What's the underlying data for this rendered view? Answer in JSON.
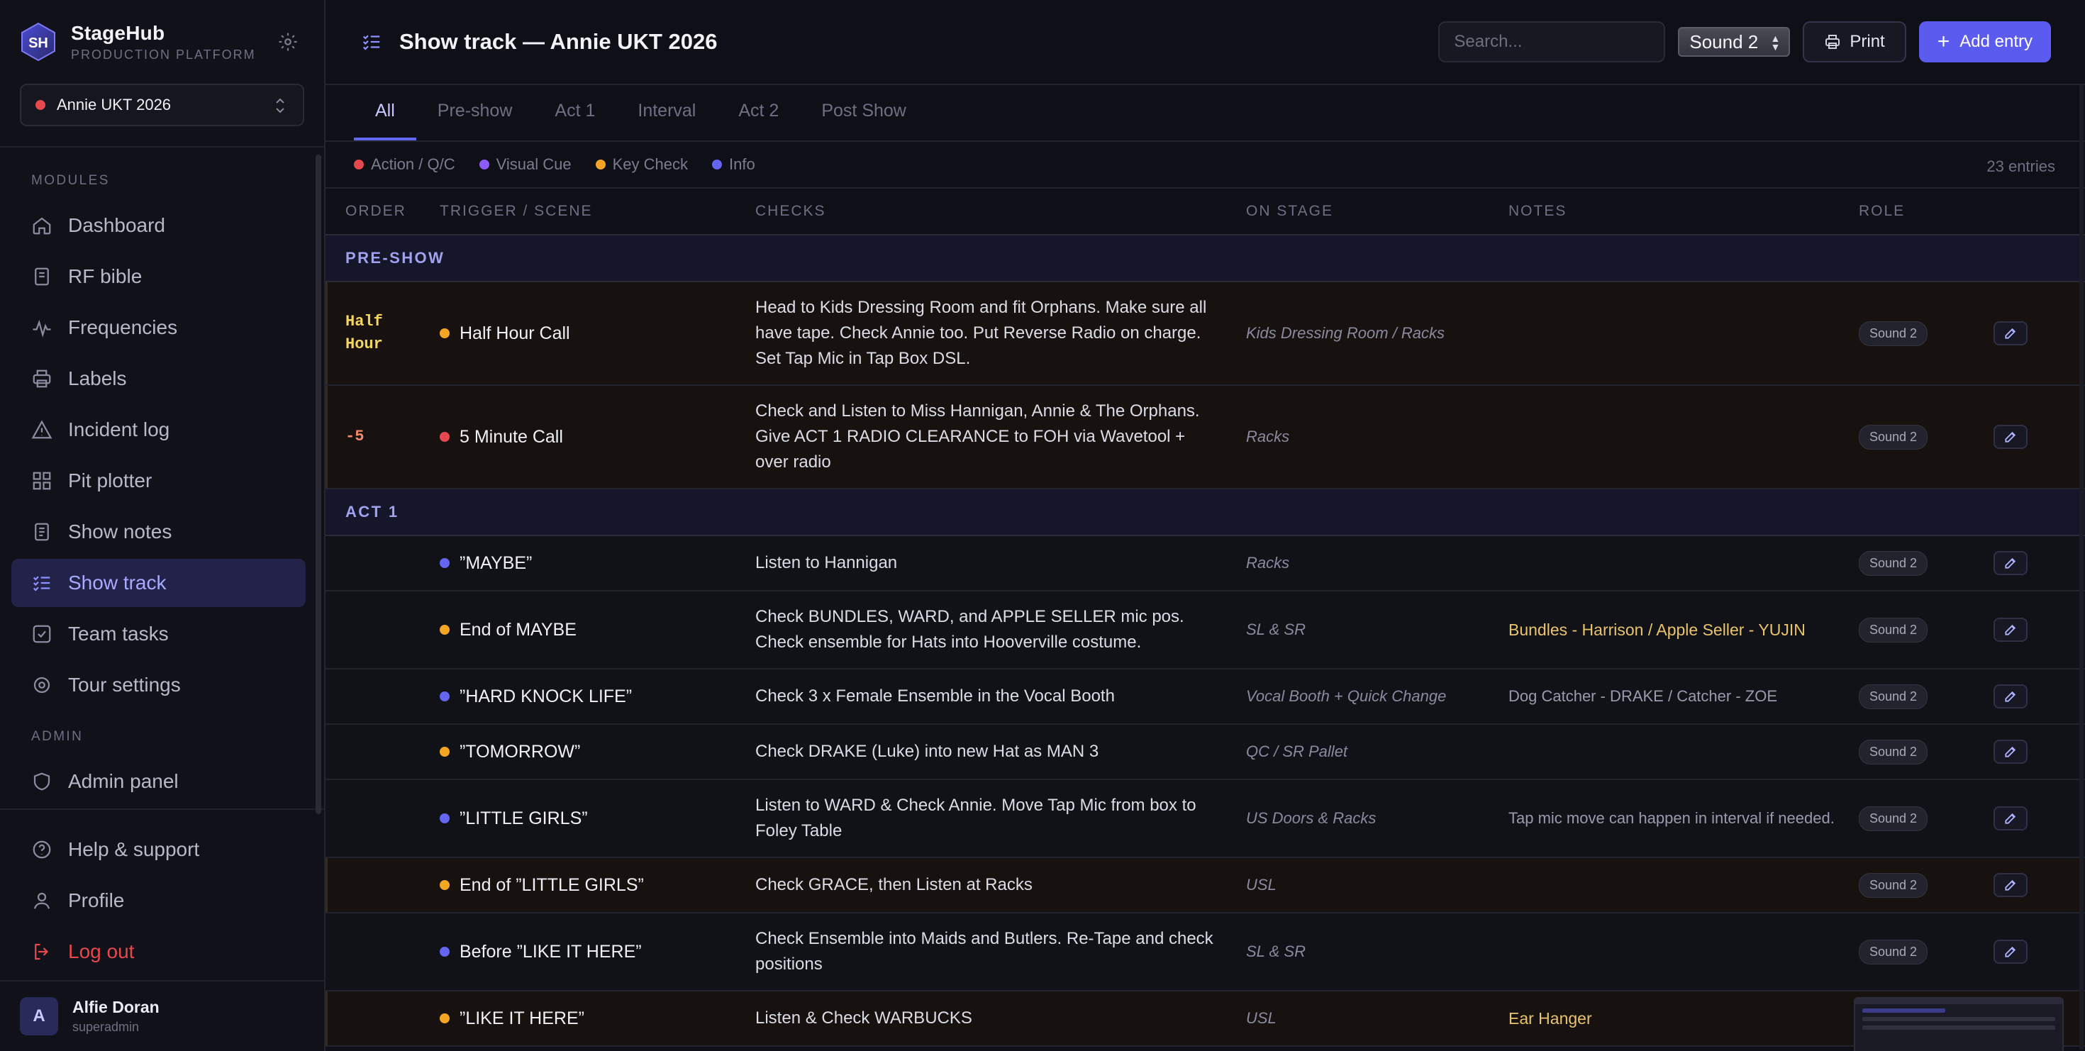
{
  "app": {
    "name": "StageHub",
    "subtitle": "PRODUCTION PLATFORM",
    "logo_text": "SH"
  },
  "production": {
    "label": "Annie UKT 2026",
    "status_color": "#e5484d"
  },
  "sidebar": {
    "modules_label": "MODULES",
    "items": [
      {
        "label": "Dashboard",
        "icon": "home-icon"
      },
      {
        "label": "RF bible",
        "icon": "book-icon"
      },
      {
        "label": "Frequencies",
        "icon": "activity-icon"
      },
      {
        "label": "Labels",
        "icon": "printer-icon"
      },
      {
        "label": "Incident log",
        "icon": "warning-icon"
      },
      {
        "label": "Pit plotter",
        "icon": "grid-icon"
      },
      {
        "label": "Show notes",
        "icon": "notes-icon"
      },
      {
        "label": "Show track",
        "icon": "list-checks-icon",
        "active": true
      },
      {
        "label": "Team tasks",
        "icon": "check-square-icon"
      },
      {
        "label": "Tour settings",
        "icon": "gear-icon"
      }
    ],
    "admin_label": "ADMIN",
    "admin_items": [
      {
        "label": "Admin panel",
        "icon": "shield-icon"
      }
    ],
    "bottom_items": [
      {
        "label": "Help & support",
        "icon": "help-icon"
      },
      {
        "label": "Profile",
        "icon": "user-icon"
      },
      {
        "label": "Log out",
        "icon": "logout-icon"
      }
    ]
  },
  "user": {
    "initial": "A",
    "name": "Alfie Doran",
    "role": "superadmin"
  },
  "header": {
    "title": "Show track — Annie UKT 2026",
    "search_placeholder": "Search...",
    "role_selected": "Sound 2",
    "print_label": "Print",
    "add_label": "Add entry"
  },
  "tabs": [
    "All",
    "Pre-show",
    "Act 1",
    "Interval",
    "Act 2",
    "Post Show"
  ],
  "active_tab": "All",
  "legend": [
    {
      "label": "Action / Q/C",
      "color": "#e5484d"
    },
    {
      "label": "Visual Cue",
      "color": "#8b5cf6"
    },
    {
      "label": "Key Check",
      "color": "#f5a524"
    },
    {
      "label": "Info",
      "color": "#6366f1"
    }
  ],
  "entries_count": "23 entries",
  "columns": [
    "ORDER",
    "TRIGGER / SCENE",
    "CHECKS",
    "ON STAGE",
    "NOTES",
    "ROLE"
  ],
  "sections": [
    {
      "title": "PRE-SHOW",
      "rows": [
        {
          "order": "Half Hour",
          "order_color": "yellow",
          "trigger": "Half Hour Call",
          "dot": "c-orange",
          "checks": "Head to Kids Dressing Room and fit Orphans. Make sure all have tape. Check Annie too. Put Reverse Radio on charge. Set Tap Mic in Tap Box DSL.",
          "on_stage": "Kids Dressing Room / Racks",
          "notes": "",
          "role": "Sound 2"
        },
        {
          "order": "-5",
          "order_color": "red",
          "trigger": "5 Minute Call",
          "dot": "c-red",
          "checks": "Check and Listen to Miss Hannigan, Annie & The Orphans. Give ACT 1 RADIO CLEARANCE to FOH via Wavetool + over radio",
          "on_stage": "Racks",
          "notes": "",
          "role": "Sound 2"
        }
      ]
    },
    {
      "title": "ACT 1",
      "rows": [
        {
          "order": "",
          "trigger": "”MAYBE”",
          "dot": "c-blue",
          "checks": "Listen to Hannigan",
          "on_stage": "Racks",
          "notes": "",
          "role": "Sound 2"
        },
        {
          "order": "",
          "trigger": "End of MAYBE",
          "dot": "c-orange",
          "checks": "Check BUNDLES, WARD, and APPLE SELLER mic pos. Check ensemble for Hats into Hooverville costume.",
          "on_stage": "SL & SR",
          "notes": "Bundles - Harrison / Apple Seller - YUJIN",
          "notes_style": "gold",
          "role": "Sound 2"
        },
        {
          "order": "",
          "trigger": "”HARD KNOCK LIFE”",
          "dot": "c-blue",
          "checks": "Check 3 x Female Ensemble in the Vocal Booth",
          "on_stage": "Vocal Booth + Quick Change",
          "notes": "Dog Catcher - DRAKE / Catcher - ZOE",
          "role": "Sound 2"
        },
        {
          "order": "",
          "trigger": "”TOMORROW”",
          "dot": "c-orange",
          "checks": "Check DRAKE (Luke) into new Hat as MAN 3",
          "on_stage": "QC / SR Pallet",
          "notes": "",
          "role": "Sound 2"
        },
        {
          "order": "",
          "trigger": "”LITTLE GIRLS”",
          "dot": "c-blue",
          "checks": "Listen to WARD & Check Annie. Move Tap Mic from box to Foley Table",
          "on_stage": "US Doors & Racks",
          "notes": "Tap mic move can happen in interval if needed.",
          "role": "Sound 2"
        },
        {
          "order": "",
          "trigger": "End of ”LITTLE GIRLS”",
          "dot": "c-orange",
          "checks": "Check GRACE, then Listen at Racks",
          "on_stage": "USL",
          "notes": "",
          "role": "Sound 2",
          "warm": true
        },
        {
          "order": "",
          "trigger": "Before ”LIKE IT HERE”",
          "dot": "c-blue",
          "checks": "Check Ensemble into Maids and Butlers. Re-Tape and check positions",
          "on_stage": "SL & SR",
          "notes": "",
          "role": "Sound 2"
        },
        {
          "order": "",
          "trigger": "”LIKE IT HERE”",
          "dot": "c-orange",
          "checks": "Listen & Check WARBUCKS",
          "on_stage": "USL",
          "notes": "Ear Hanger",
          "notes_style": "gold",
          "role": "",
          "warm": true
        }
      ]
    }
  ]
}
